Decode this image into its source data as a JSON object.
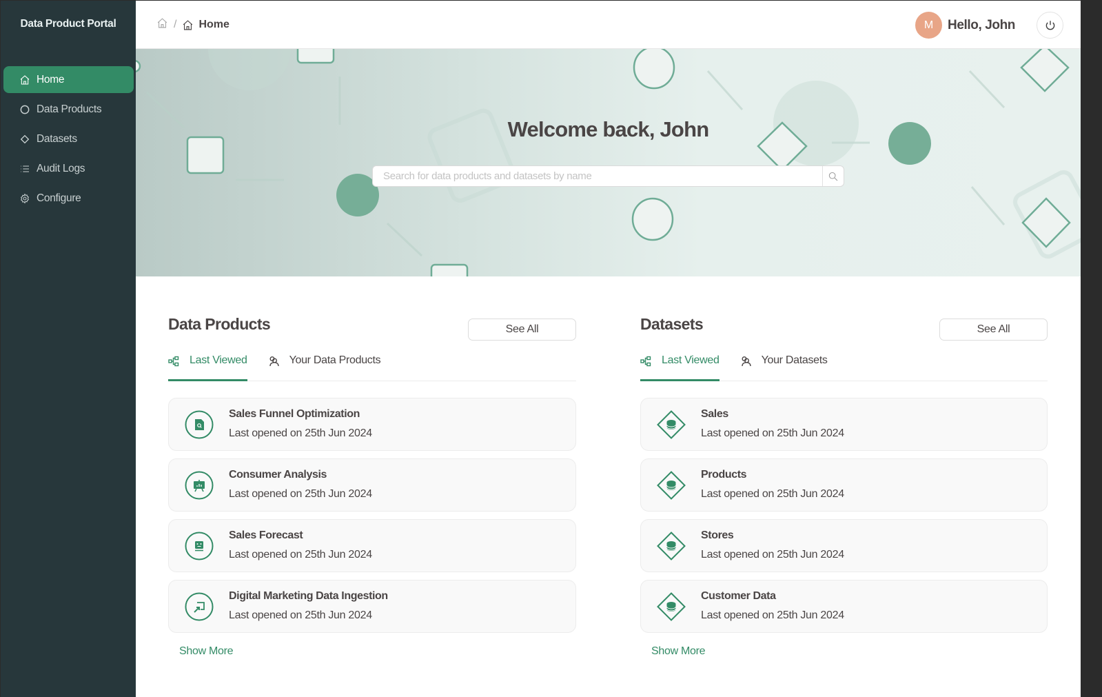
{
  "app": {
    "title": "Data Product Portal"
  },
  "sidebar": {
    "items": [
      {
        "label": "Home",
        "icon": "home-icon",
        "active": true
      },
      {
        "label": "Data Products",
        "icon": "circle-icon",
        "active": false
      },
      {
        "label": "Datasets",
        "icon": "diamond-icon",
        "active": false
      },
      {
        "label": "Audit Logs",
        "icon": "list-icon",
        "active": false
      },
      {
        "label": "Configure",
        "icon": "gear-icon",
        "active": false
      }
    ]
  },
  "header": {
    "breadcrumb": {
      "separator": "/",
      "current": "Home"
    },
    "user": {
      "avatar_initial": "M",
      "greeting": "Hello, John",
      "avatar_color": "#e8a587"
    },
    "logout_icon": "power-icon"
  },
  "hero": {
    "title": "Welcome back, John",
    "search": {
      "placeholder": "Search for data products and datasets by name",
      "value": ""
    }
  },
  "colors": {
    "accent": "#338b66",
    "sidebar": "#27373b",
    "text": "#4a4545"
  },
  "data_products": {
    "title": "Data Products",
    "see_all": "See All",
    "tabs": [
      {
        "label": "Last Viewed",
        "icon": "hierarchy-icon",
        "active": true
      },
      {
        "label": "Your Data Products",
        "icon": "users-icon",
        "active": false
      }
    ],
    "items": [
      {
        "name": "Sales Funnel Optimization",
        "meta": "Last opened on 25th Jun 2024",
        "icon": "file-search-icon"
      },
      {
        "name": "Consumer Analysis",
        "meta": "Last opened on 25th Jun 2024",
        "icon": "presentation-chart-icon"
      },
      {
        "name": "Sales Forecast",
        "meta": "Last opened on 25th Jun 2024",
        "icon": "robot-icon"
      },
      {
        "name": "Digital Marketing Data Ingestion",
        "meta": "Last opened on 25th Jun 2024",
        "icon": "import-icon"
      }
    ],
    "show_more": "Show More"
  },
  "datasets": {
    "title": "Datasets",
    "see_all": "See All",
    "tabs": [
      {
        "label": "Last Viewed",
        "icon": "hierarchy-icon",
        "active": true
      },
      {
        "label": "Your Datasets",
        "icon": "users-icon",
        "active": false
      }
    ],
    "items": [
      {
        "name": "Sales",
        "meta": "Last opened on 25th Jun 2024",
        "icon": "database-diamond-icon"
      },
      {
        "name": "Products",
        "meta": "Last opened on 25th Jun 2024",
        "icon": "database-diamond-icon"
      },
      {
        "name": "Stores",
        "meta": "Last opened on 25th Jun 2024",
        "icon": "database-diamond-icon"
      },
      {
        "name": "Customer Data",
        "meta": "Last opened on 25th Jun 2024",
        "icon": "database-diamond-icon"
      }
    ],
    "show_more": "Show More"
  }
}
